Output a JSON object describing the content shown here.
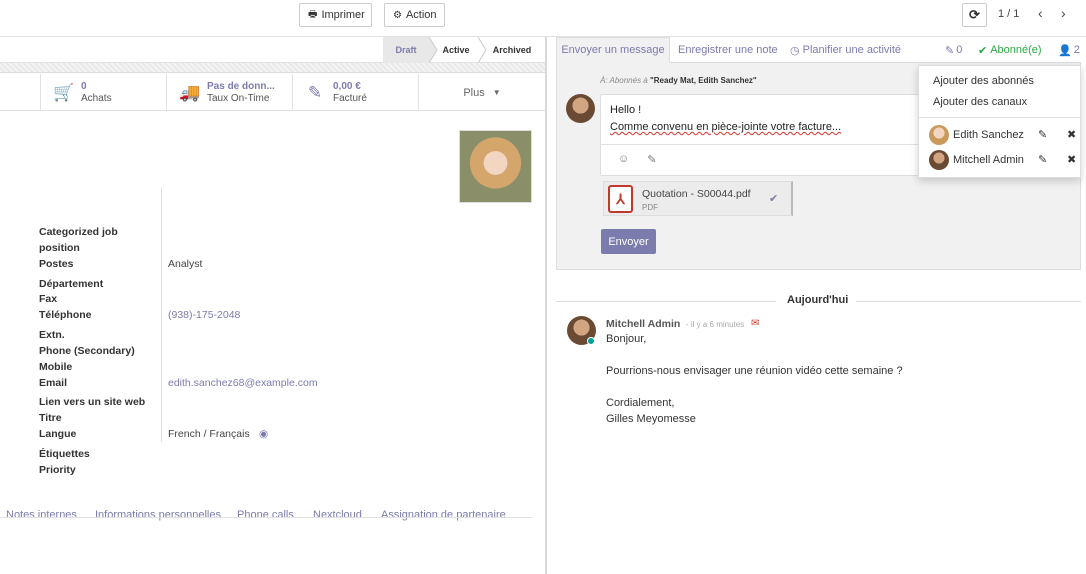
{
  "toolbar": {
    "print_label": "Imprimer",
    "print_icon": "print-icon",
    "action_label": "Action",
    "action_icon": "gear-icon",
    "reload_icon": "refresh-icon",
    "pager": "1 / 1"
  },
  "statusbar": {
    "stages": [
      "Draft",
      "Active",
      "Archived"
    ],
    "current": "Draft"
  },
  "smart_buttons": {
    "purchases": {
      "value": "0",
      "label": "Achats",
      "icon": "cart-icon"
    },
    "ontime": {
      "value": "Pas de donn...",
      "label": "Taux On-Time",
      "icon": "truck-icon"
    },
    "invoiced": {
      "value": "0,00 €",
      "label": "Facturé",
      "icon": "pencil-square-icon"
    },
    "more": "Plus"
  },
  "fields": [
    {
      "label": "Categorized job",
      "value": ""
    },
    {
      "label": "position",
      "value": ""
    },
    {
      "label": "Postes",
      "value": "Analyst"
    },
    {
      "label": "Département",
      "value": ""
    },
    {
      "label": "Fax",
      "value": ""
    },
    {
      "label": "Téléphone",
      "value": "(938)-175-2048"
    },
    {
      "label": "Extn.",
      "value": ""
    },
    {
      "label": "Phone (Secondary)",
      "value": ""
    },
    {
      "label": "Mobile",
      "value": ""
    },
    {
      "label": "Email",
      "value": "edith.sanchez68@example.com"
    },
    {
      "label": "Lien vers un site web",
      "value": ""
    },
    {
      "label": "Titre",
      "value": ""
    },
    {
      "label": "Langue",
      "value": "French / Français"
    },
    {
      "label": "Étiquettes",
      "value": ""
    },
    {
      "label": "Priority",
      "value": ""
    }
  ],
  "tabs": [
    "Notes internes",
    "Informations personnelles",
    "Phone calls",
    "Nextcloud",
    "Assignation de partenaire"
  ],
  "chatter": {
    "send_tab": "Envoyer un message",
    "note_tab": "Enregistrer une note",
    "plan_tab": "Planifier une activité",
    "attachments_count": "0",
    "followed_label": "Abonné(e)",
    "followers_count": "2",
    "to_prefix": "À: Abonnés à",
    "to_record": "\"Ready Mat, Edith Sanchez\"",
    "draft_line1": "Hello !",
    "draft_line2": "Comme convenu en pièce-jointe votre facture...",
    "attachment_name": "Quotation - S00044.pdf",
    "attachment_type": "PDF",
    "send_button": "Envoyer",
    "today_label": "Aujourd'hui",
    "message": {
      "author": "Mitchell Admin",
      "time": "- il y a 6 minutes",
      "lines": [
        "Bonjour,",
        "",
        "Pourrions-nous envisager une réunion vidéo cette semaine ?",
        "",
        "Cordialement,",
        "Gilles Meyomesse"
      ]
    }
  },
  "followers_dropdown": {
    "add_followers": "Ajouter des abonnés",
    "add_channels": "Ajouter des canaux",
    "followers": [
      "Edith Sanchez",
      "Mitchell Admin"
    ]
  },
  "colors": {
    "accent": "#7c7bad",
    "success": "#28a745",
    "danger": "#d9342b"
  }
}
